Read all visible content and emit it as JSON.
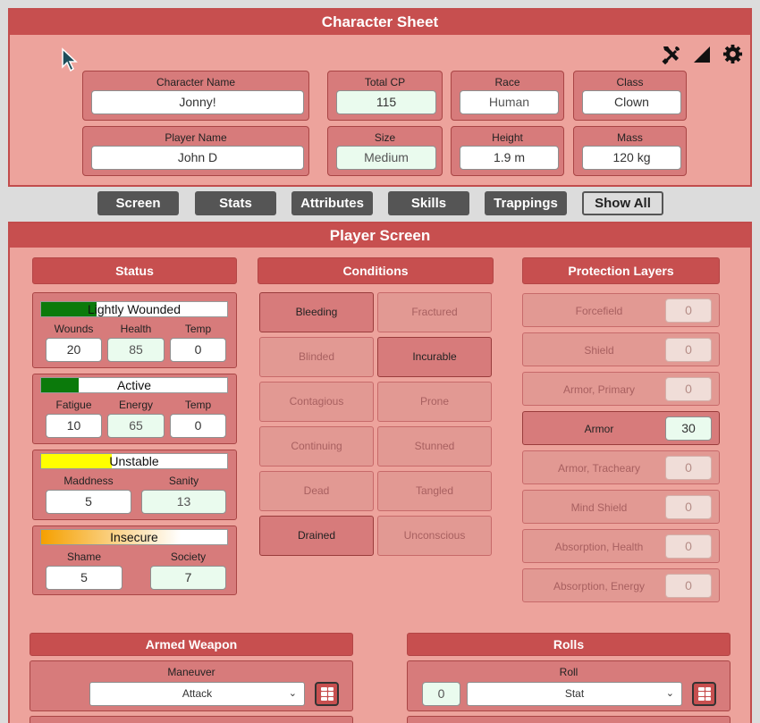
{
  "sheet": {
    "title": "Character Sheet",
    "fields": {
      "character_name": {
        "label": "Character Name",
        "value": "Jonny!"
      },
      "total_cp": {
        "label": "Total CP",
        "value": "115"
      },
      "race": {
        "label": "Race",
        "value": "Human"
      },
      "class": {
        "label": "Class",
        "value": "Clown"
      },
      "player_name": {
        "label": "Player Name",
        "value": "John D"
      },
      "size": {
        "label": "Size",
        "value": "Medium"
      },
      "height": {
        "label": "Height",
        "value": "1.9 m"
      },
      "mass": {
        "label": "Mass",
        "value": "120 kg"
      }
    },
    "toolbar_icons": [
      "tools-icon",
      "signal-icon",
      "gear-icon"
    ]
  },
  "tabs": [
    "Screen",
    "Stats",
    "Attributes",
    "Skills",
    "Trappings",
    "Show All"
  ],
  "active_tab": "Show All",
  "player_screen": {
    "title": "Player Screen",
    "status": {
      "title": "Status",
      "groups": [
        {
          "bar_label": "Lightly Wounded",
          "bar_fraction": 0.3,
          "bar_color": "#0b7a0b",
          "fields": [
            {
              "label": "Wounds",
              "value": "20"
            },
            {
              "label": "Health",
              "value": "85"
            },
            {
              "label": "Temp",
              "value": "0"
            }
          ]
        },
        {
          "bar_label": "Active",
          "bar_fraction": 0.2,
          "bar_color": "#0b7a0b",
          "fields": [
            {
              "label": "Fatigue",
              "value": "10"
            },
            {
              "label": "Energy",
              "value": "65"
            },
            {
              "label": "Temp",
              "value": "0"
            }
          ]
        },
        {
          "bar_label": "Unstable",
          "bar_fraction": 0.38,
          "bar_color": "#ffff00",
          "fields": [
            {
              "label": "Maddness",
              "value": "5"
            },
            {
              "label": "Sanity",
              "value": "13"
            }
          ]
        },
        {
          "bar_label": "Insecure",
          "bar_fraction": 0.75,
          "bar_color": "#f5a000",
          "fields": [
            {
              "label": "Shame",
              "value": "5"
            },
            {
              "label": "Society",
              "value": "7"
            }
          ]
        }
      ]
    },
    "conditions": {
      "title": "Conditions",
      "items": [
        {
          "label": "Bleeding",
          "active": true
        },
        {
          "label": "Fractured",
          "active": false
        },
        {
          "label": "Blinded",
          "active": false
        },
        {
          "label": "Incurable",
          "active": true
        },
        {
          "label": "Contagious",
          "active": false
        },
        {
          "label": "Prone",
          "active": false
        },
        {
          "label": "Continuing",
          "active": false
        },
        {
          "label": "Stunned",
          "active": false
        },
        {
          "label": "Dead",
          "active": false
        },
        {
          "label": "Tangled",
          "active": false
        },
        {
          "label": "Drained",
          "active": true
        },
        {
          "label": "Unconscious",
          "active": false
        }
      ]
    },
    "protection": {
      "title": "Protection Layers",
      "items": [
        {
          "label": "Forcefield",
          "value": "0",
          "active": false
        },
        {
          "label": "Shield",
          "value": "0",
          "active": false
        },
        {
          "label": "Armor, Primary",
          "value": "0",
          "active": false
        },
        {
          "label": "Armor",
          "value": "30",
          "active": true
        },
        {
          "label": "Armor, Tracheary",
          "value": "0",
          "active": false
        },
        {
          "label": "Mind Shield",
          "value": "0",
          "active": false
        },
        {
          "label": "Absorption, Health",
          "value": "0",
          "active": false
        },
        {
          "label": "Absorption, Energy",
          "value": "0",
          "active": false
        }
      ]
    },
    "armed_weapon": {
      "title": "Armed Weapon",
      "maneuver_label": "Maneuver",
      "maneuver_value": "Attack"
    },
    "rolls": {
      "title": "Rolls",
      "roll_label": "Roll",
      "roll_modifier": "0",
      "roll_value": "Stat"
    }
  }
}
